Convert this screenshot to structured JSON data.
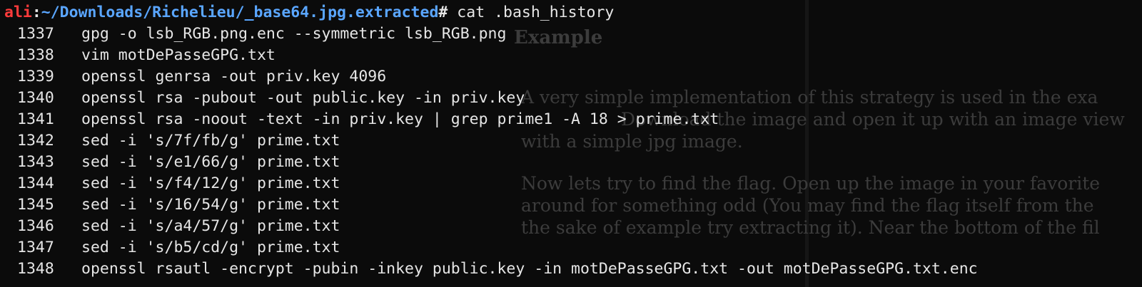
{
  "prompt": {
    "user": "ali",
    "colon": ":",
    "path": "~/Downloads/Richelieu/_base64.jpg.extracted",
    "symbol": "#",
    "command": " cat .bash_history"
  },
  "history": [
    {
      "num": "1337",
      "cmd": "gpg -o lsb_RGB.png.enc --symmetric lsb_RGB.png"
    },
    {
      "num": "1338",
      "cmd": "vim motDePasseGPG.txt"
    },
    {
      "num": "1339",
      "cmd": "openssl genrsa -out priv.key 4096"
    },
    {
      "num": "1340",
      "cmd": "openssl rsa -pubout -out public.key -in priv.key"
    },
    {
      "num": "1341",
      "cmd": "openssl rsa -noout -text -in priv.key | grep prime1 -A 18 > prime.txt"
    },
    {
      "num": "1342",
      "cmd": "sed -i 's/7f/fb/g' prime.txt"
    },
    {
      "num": "1343",
      "cmd": "sed -i 's/e1/66/g' prime.txt"
    },
    {
      "num": "1344",
      "cmd": "sed -i 's/f4/12/g' prime.txt"
    },
    {
      "num": "1345",
      "cmd": "sed -i 's/16/54/g' prime.txt"
    },
    {
      "num": "1346",
      "cmd": "sed -i 's/a4/57/g' prime.txt"
    },
    {
      "num": "1347",
      "cmd": "sed -i 's/b5/cd/g' prime.txt"
    },
    {
      "num": "1348",
      "cmd": "openssl rsautl -encrypt -pubin -inkey public.key -in motDePasseGPG.txt -out motDePasseGPG.txt.enc"
    }
  ],
  "background_document": {
    "heading": "Example",
    "para1": [
      "A very simple implementation of this strategy is used in the exa",
      "Download the image and open it up with an image view",
      "with a simple jpg image."
    ],
    "para2": [
      "Now lets try to find the flag. Open up the image in your favorite",
      "around for something odd (You may find the flag itself from the",
      "the sake of example try extracting it). Near the bottom of the fil"
    ]
  },
  "colors": {
    "user": "#ff3b3b",
    "path": "#5aa6ff",
    "text": "#e6e6e6",
    "background": "#0b0b0b"
  }
}
